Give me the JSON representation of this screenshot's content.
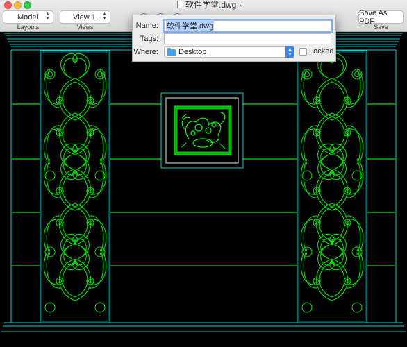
{
  "window": {
    "title": "软件学堂.dwg"
  },
  "toolbar": {
    "layout_value": "Model",
    "layout_caption": "Layouts",
    "view_value": "View 1",
    "view_caption": "Views",
    "save_pdf_label": "Save As PDF",
    "save_caption": "Save"
  },
  "save_sheet": {
    "name_label": "Name:",
    "name_value": "软件学堂.dwg",
    "tags_label": "Tags:",
    "tags_value": "",
    "where_label": "Where:",
    "where_value": "Desktop",
    "locked_label": "Locked",
    "locked_checked": false
  },
  "colors": {
    "cad_green": "#00e000",
    "cad_cyan": "#00d6d6",
    "canvas": "#000000"
  }
}
